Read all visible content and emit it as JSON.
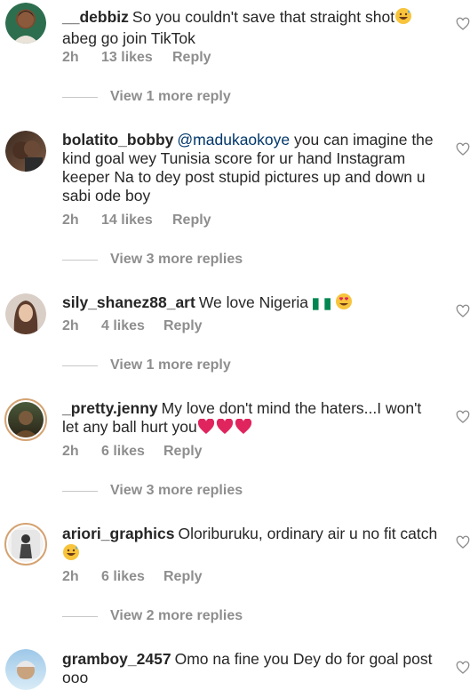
{
  "comments": [
    {
      "username": "__debbiz",
      "text": "So you couldn't save that straight shot",
      "text2": "abeg go join TikTok",
      "time": "2h",
      "likes": "13 likes",
      "reply": "Reply",
      "view_more": "View 1 more reply",
      "emoji": "grinning-sweat-emoji"
    },
    {
      "username": "bolatito_bobby",
      "mention": "@madukaokoye",
      "text_line1": "you can imagine the",
      "text_line2": "kind goal wey Tunisia score for ur hand Instagram",
      "text_line3": "keeper Na to dey post stupid pictures up and down u",
      "text_line4": "sabi ode boy",
      "time": "2h",
      "likes": "14 likes",
      "reply": "Reply",
      "view_more": "View 3 more replies"
    },
    {
      "username": "sily_shanez88_art",
      "text": "We love Nigeria",
      "time": "2h",
      "likes": "4 likes",
      "reply": "Reply",
      "view_more": "View 1 more reply"
    },
    {
      "username": "_pretty.jenny",
      "text": "My love don't mind the haters...I won't",
      "text2": "let any ball hurt you",
      "time": "2h",
      "likes": "6 likes",
      "reply": "Reply",
      "view_more": "View 3 more replies"
    },
    {
      "username": "ariori_graphics",
      "text": "Oloriburuku, ordinary air u no fit catch",
      "time": "2h",
      "likes": "6 likes",
      "reply": "Reply",
      "view_more": "View 2 more replies"
    },
    {
      "username": "gramboy_2457",
      "text": "Omo na fine you Dey do for goal post",
      "text2": "ooo"
    }
  ],
  "colors": {
    "text": "#262626",
    "meta": "#8e8e8e",
    "mention": "#00376b",
    "heart_outline": "#8e8e8e",
    "red_heart": "#e0245e"
  }
}
